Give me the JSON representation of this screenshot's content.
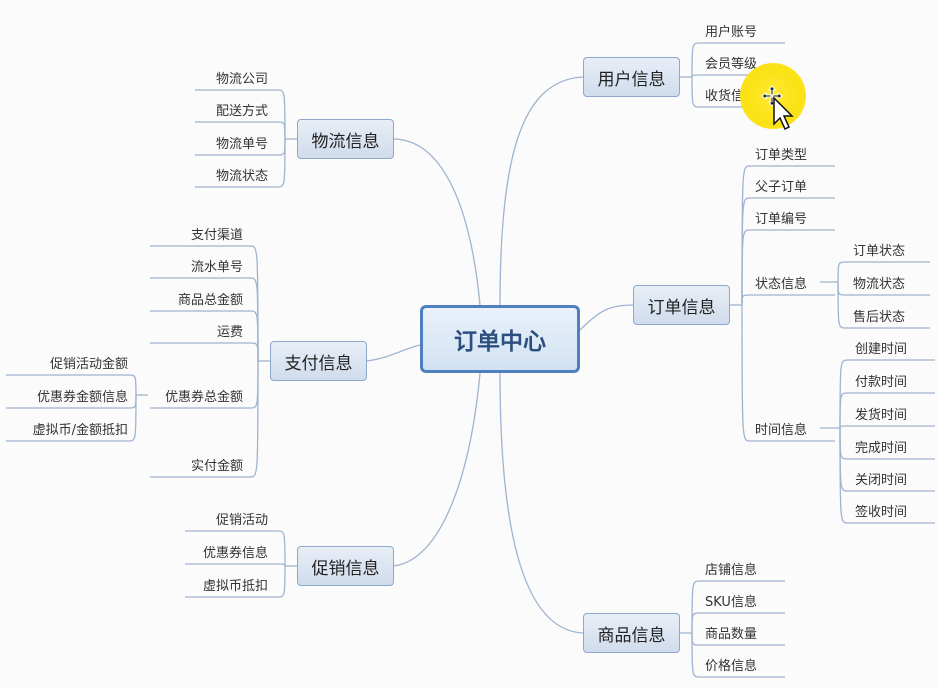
{
  "root": "订单中心",
  "branches": {
    "user": {
      "label": "用户信息",
      "items": [
        "用户账号",
        "会员等级",
        "收货信息"
      ]
    },
    "order": {
      "label": "订单信息",
      "items": [
        "订单类型",
        "父子订单",
        "订单编号"
      ],
      "status": {
        "label": "状态信息",
        "items": [
          "订单状态",
          "物流状态",
          "售后状态"
        ]
      },
      "time": {
        "label": "时间信息",
        "items": [
          "创建时间",
          "付款时间",
          "发货时间",
          "完成时间",
          "关闭时间",
          "签收时间"
        ]
      }
    },
    "goods": {
      "label": "商品信息",
      "items": [
        "店铺信息",
        "SKU信息",
        "商品数量",
        "价格信息"
      ]
    },
    "logistics": {
      "label": "物流信息",
      "items": [
        "物流公司",
        "配送方式",
        "物流单号",
        "物流状态"
      ]
    },
    "payment": {
      "label": "支付信息",
      "items": [
        "支付渠道",
        "流水单号",
        "商品总金额",
        "运费",
        "实付金额"
      ],
      "coupon": {
        "label": "优惠券总金额",
        "items": [
          "促销活动金额",
          "优惠券金额信息",
          "虚拟币/金额抵扣"
        ]
      }
    },
    "promo": {
      "label": "促销信息",
      "items": [
        "促销活动",
        "优惠券信息",
        "虚拟币抵扣"
      ]
    }
  }
}
